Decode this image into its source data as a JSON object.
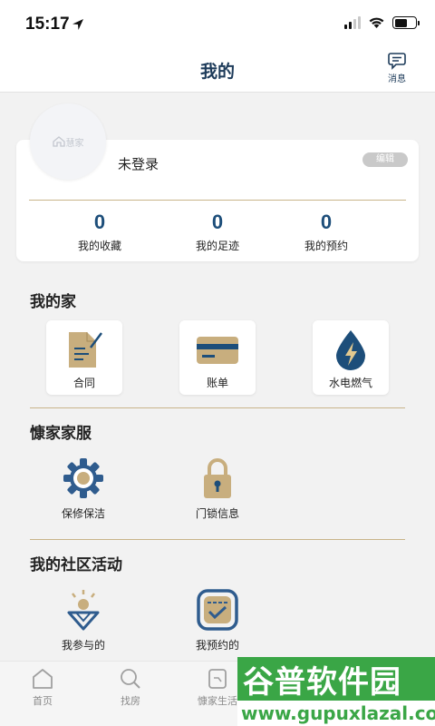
{
  "status_bar": {
    "time": "15:17"
  },
  "header": {
    "title": "我的",
    "message_label": "消息"
  },
  "profile": {
    "avatar_logo_text": "慧家",
    "login_status": "未登录",
    "edit_label": "编辑",
    "stats": [
      {
        "value": "0",
        "label": "我的收藏"
      },
      {
        "value": "0",
        "label": "我的足迹"
      },
      {
        "value": "0",
        "label": "我的预约"
      }
    ]
  },
  "my_home": {
    "title": "我的家",
    "items": [
      {
        "label": "合同",
        "icon": "contract-icon"
      },
      {
        "label": "账单",
        "icon": "bill-card-icon"
      },
      {
        "label": "水电燃气",
        "icon": "utility-drop-icon"
      }
    ]
  },
  "home_service": {
    "title": "慷家家服",
    "items": [
      {
        "label": "保修保洁",
        "icon": "gear-icon"
      },
      {
        "label": "门锁信息",
        "icon": "lock-icon"
      }
    ]
  },
  "community": {
    "title": "我的社区活动",
    "items": [
      {
        "label": "我参与的",
        "icon": "participate-icon"
      },
      {
        "label": "我预约的",
        "icon": "appointment-icon"
      }
    ]
  },
  "tab_bar": {
    "tabs": [
      {
        "label": "首页",
        "icon": "home-icon"
      },
      {
        "label": "找房",
        "icon": "search-icon"
      },
      {
        "label": "慷家生活",
        "icon": "life-icon"
      }
    ]
  },
  "watermark": {
    "main": "谷普软件园",
    "url": "www.gupuxlazal.com"
  },
  "colors": {
    "accent": "#1d4e7a",
    "gold": "#c8b48a",
    "watermark_green": "#3aa646"
  }
}
